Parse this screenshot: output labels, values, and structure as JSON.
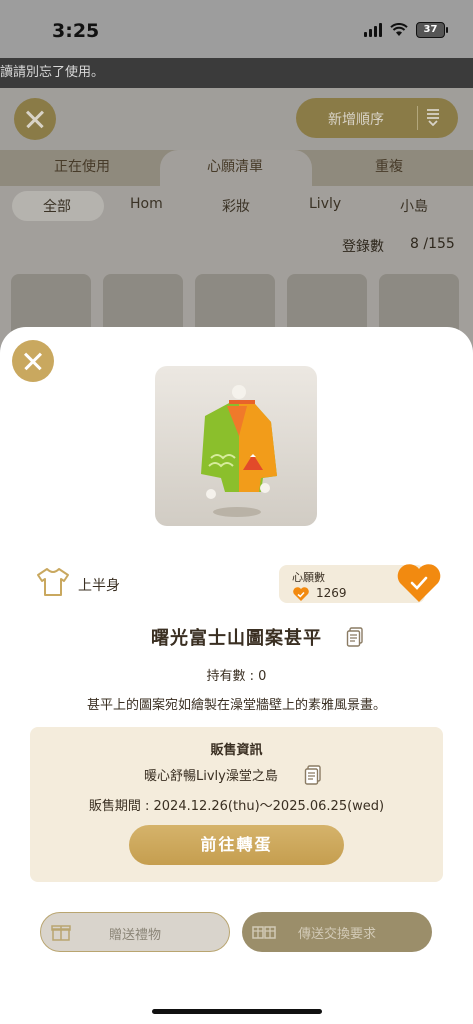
{
  "status": {
    "time": "3:25",
    "battery": "37"
  },
  "notice": "讀請別忘了使用。",
  "toolbar": {
    "sort_label": "新增順序"
  },
  "tabs": [
    {
      "label": "正在使用"
    },
    {
      "label": "心願清單"
    },
    {
      "label": "重複"
    }
  ],
  "subtabs": [
    {
      "label": "全部"
    },
    {
      "label": "Hom"
    },
    {
      "label": "彩妝"
    },
    {
      "label": "Livly"
    },
    {
      "label": "小島"
    }
  ],
  "registry": {
    "label": "登錄數",
    "value": "8 /155"
  },
  "item": {
    "category": "上半身",
    "wish_title": "心願數",
    "wish_count": "1269",
    "name": "曙光富士山圖案甚平",
    "owned": "持有數 : 0",
    "description": "甚平上的圖案宛如繪製在澡堂牆壁上的素雅風景畫。"
  },
  "sale": {
    "title": "販售資訊",
    "place": "暖心舒暢Livly澡堂之島",
    "period": "販售期間 : 2024.12.26(thu)～2025.06.25(wed)",
    "go_label": "前往轉蛋"
  },
  "actions": {
    "gift_label": "贈送禮物",
    "trade_label": "傳送交換要求"
  },
  "colors": {
    "accent": "#c9a85f",
    "heart": "#f28a10",
    "panel": "#f4ecdc"
  }
}
